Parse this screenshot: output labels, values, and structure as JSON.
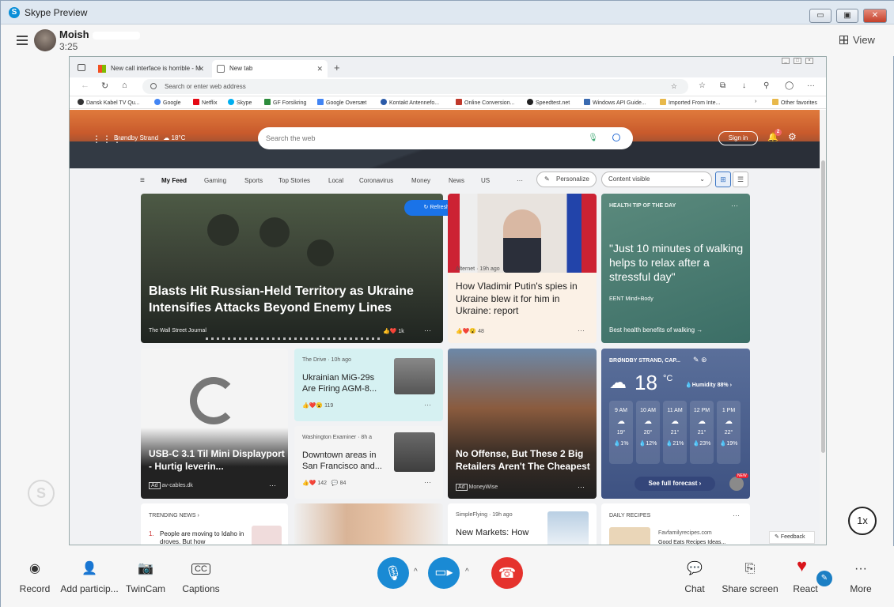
{
  "window": {
    "title": "Skype Preview",
    "minimize": "▭",
    "maximize": "▣",
    "close": "✕"
  },
  "call": {
    "contact_name": "Moish",
    "duration": "3:25",
    "view_label": "View",
    "playback_rate": "1x"
  },
  "browser": {
    "tabs": [
      {
        "label": "New call interface is horrible - M",
        "active": false
      },
      {
        "label": "New tab",
        "active": true
      }
    ],
    "address_placeholder": "Search or enter web address",
    "favorites": [
      {
        "label": "Dansk Kabel TV Qu...",
        "color": "#333333"
      },
      {
        "label": "Google",
        "color": "#4285f4"
      },
      {
        "label": "Netflix",
        "color": "#e50914"
      },
      {
        "label": "Skype",
        "color": "#00aff0"
      },
      {
        "label": "GF Forsikring",
        "color": "#2d8c3c"
      },
      {
        "label": "Google Oversæt",
        "color": "#4285f4"
      },
      {
        "label": "Kontakt Antennefo...",
        "color": "#2a5aa8"
      },
      {
        "label": "Online Conversion...",
        "color": "#c0392b"
      },
      {
        "label": "Speedtest.net",
        "color": "#222222"
      },
      {
        "label": "Windows API Guide...",
        "color": "#3a6ab0"
      },
      {
        "label": "Imported From Inte...",
        "color": "#e8b84a"
      },
      {
        "label": "Other favorites",
        "color": "#e8b84a"
      }
    ]
  },
  "msn": {
    "location": "Brøndby Strand",
    "temp_header": "18°C",
    "search_placeholder": "Search the web",
    "sign_in": "Sign in",
    "notif_count": "2",
    "feed_tabs": [
      "My Feed",
      "Gaming",
      "Sports",
      "Top Stories",
      "Local",
      "Coronavirus",
      "Money",
      "News",
      "US",
      "···"
    ],
    "personalize": "Personalize",
    "content_visible": "Content visible",
    "refresh": "Refresh stories",
    "cards": {
      "main": {
        "title": "Blasts Hit Russian-Held Territory as Ukraine Intensifies Attacks Beyond Enemy Lines",
        "source": "The Wall Street Journal",
        "reactions": "1k"
      },
      "putin": {
        "source": "Alternet · 19h ago",
        "title": "How Vladimir Putin's spies in Ukraine blew it for him in Ukraine: report",
        "reactions": "48"
      },
      "health": {
        "tag": "HEALTH TIP OF THE DAY",
        "quote": "\"Just 10 minutes of walking helps to relax after a stressful day\"",
        "source": "EENT Mind+Body",
        "link": "Best health benefits of walking →"
      },
      "usbc": {
        "title": "USB-C 3.1 Til Mini Displayport - Hurtig leverin...",
        "ad": "Ad",
        "source": "av-cables.dk"
      },
      "mig": {
        "source": "The Drive · 10h ago",
        "title": "Ukrainian MiG-29s Are Firing AGM-8...",
        "reactions": "119"
      },
      "downtown": {
        "source": "Washington Examiner · 8h a",
        "title": "Downtown areas in San Francisco and...",
        "reactions": "142",
        "comments": "84"
      },
      "store": {
        "title": "No Offense, But These 2 Big Retailers Aren't The Cheapest",
        "ad": "Ad",
        "source": "MoneyWise"
      },
      "weather": {
        "location": "BRØNDBY STRAND, CAP...",
        "temp": "18",
        "unit": "°C",
        "humidity": "Humidity 88%",
        "hours": [
          {
            "time": "9 AM",
            "temp": "19°",
            "precip": "1%"
          },
          {
            "time": "10 AM",
            "temp": "20°",
            "precip": "12%"
          },
          {
            "time": "11 AM",
            "temp": "21°",
            "precip": "21%"
          },
          {
            "time": "12 PM",
            "temp": "21°",
            "precip": "23%"
          },
          {
            "time": "1 PM",
            "temp": "22°",
            "precip": "19%"
          }
        ],
        "forecast": "See full forecast",
        "new": "NEW"
      },
      "trending": {
        "header": "TRENDING NEWS",
        "item_num": "1.",
        "item": "People are moving to Idaho in droves. But how"
      },
      "newmarkets": {
        "source": "SimpleFlying · 19h ago",
        "title": "New Markets: How"
      },
      "recipes": {
        "header": "DAILY RECIPES",
        "source": "Favfamilyrecipes.com",
        "snippet": "Good Eats Recipes Ideas..."
      }
    },
    "feedback": "Feedback"
  },
  "controls": {
    "record": "Record",
    "add": "Add particip...",
    "twincam": "TwinCam",
    "captions": "Captions",
    "chat": "Chat",
    "share": "Share screen",
    "react": "React",
    "more": "More"
  },
  "colors": {
    "accent": "#1a8ad4",
    "hangup": "#e5322d",
    "react": "#d9151b"
  }
}
